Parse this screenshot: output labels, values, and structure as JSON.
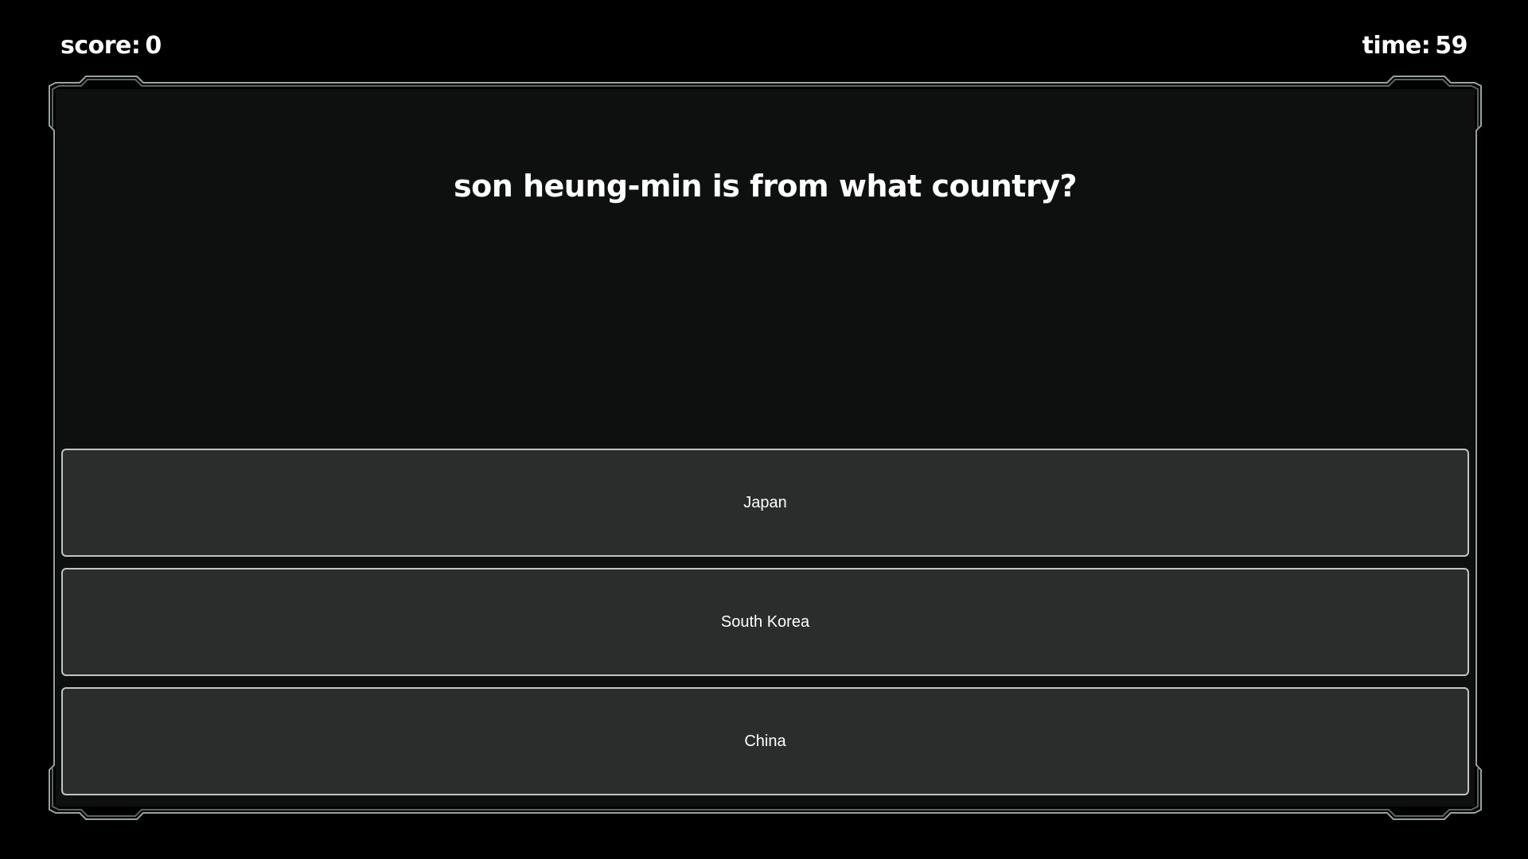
{
  "hud": {
    "score_label": "score:",
    "score_value": "0",
    "time_label": "time:",
    "time_value": "59"
  },
  "question": {
    "text": "son heung-min is from what country?"
  },
  "answers": [
    {
      "label": "Japan"
    },
    {
      "label": "South Korea"
    },
    {
      "label": "China"
    }
  ],
  "colors": {
    "background": "#000000",
    "panel": "#0e1010",
    "answer_fill": "#2b2d2d",
    "border": "#bfc6c5",
    "text": "#ffffff"
  }
}
